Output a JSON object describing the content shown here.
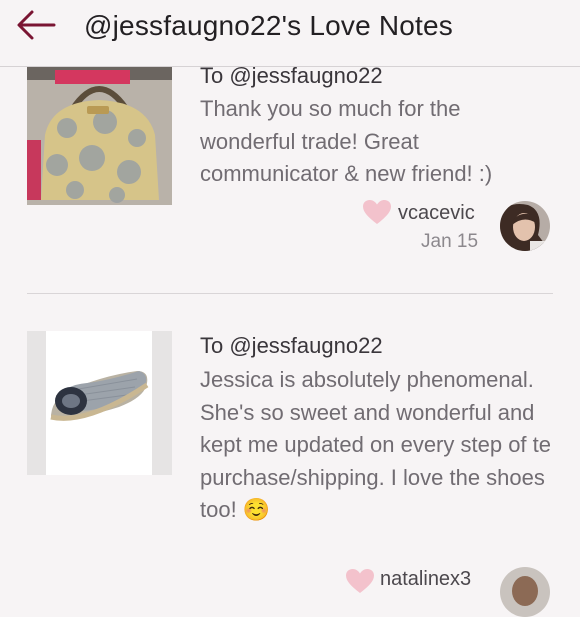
{
  "header": {
    "title": "@jessfaugno22's Love Notes",
    "back_icon": "back-arrow-icon",
    "accent_color": "#7a1533"
  },
  "notes": [
    {
      "to": "To @jessfaugno22",
      "text": "Thank you so much for the wonderful trade! Great communicator & new friend! :)",
      "username": "vcacevic",
      "date": "Jan 15",
      "heart_color": "#f3c2cc"
    },
    {
      "to": "To @jessfaugno22",
      "text": "Jessica is absolutely phenomenal. She's so sweet and wonderful and kept me updated on every step of te purchase/shipping. I love the shoes too! ☺️",
      "username": "natalinex3",
      "heart_color": "#f3c2cc"
    }
  ]
}
